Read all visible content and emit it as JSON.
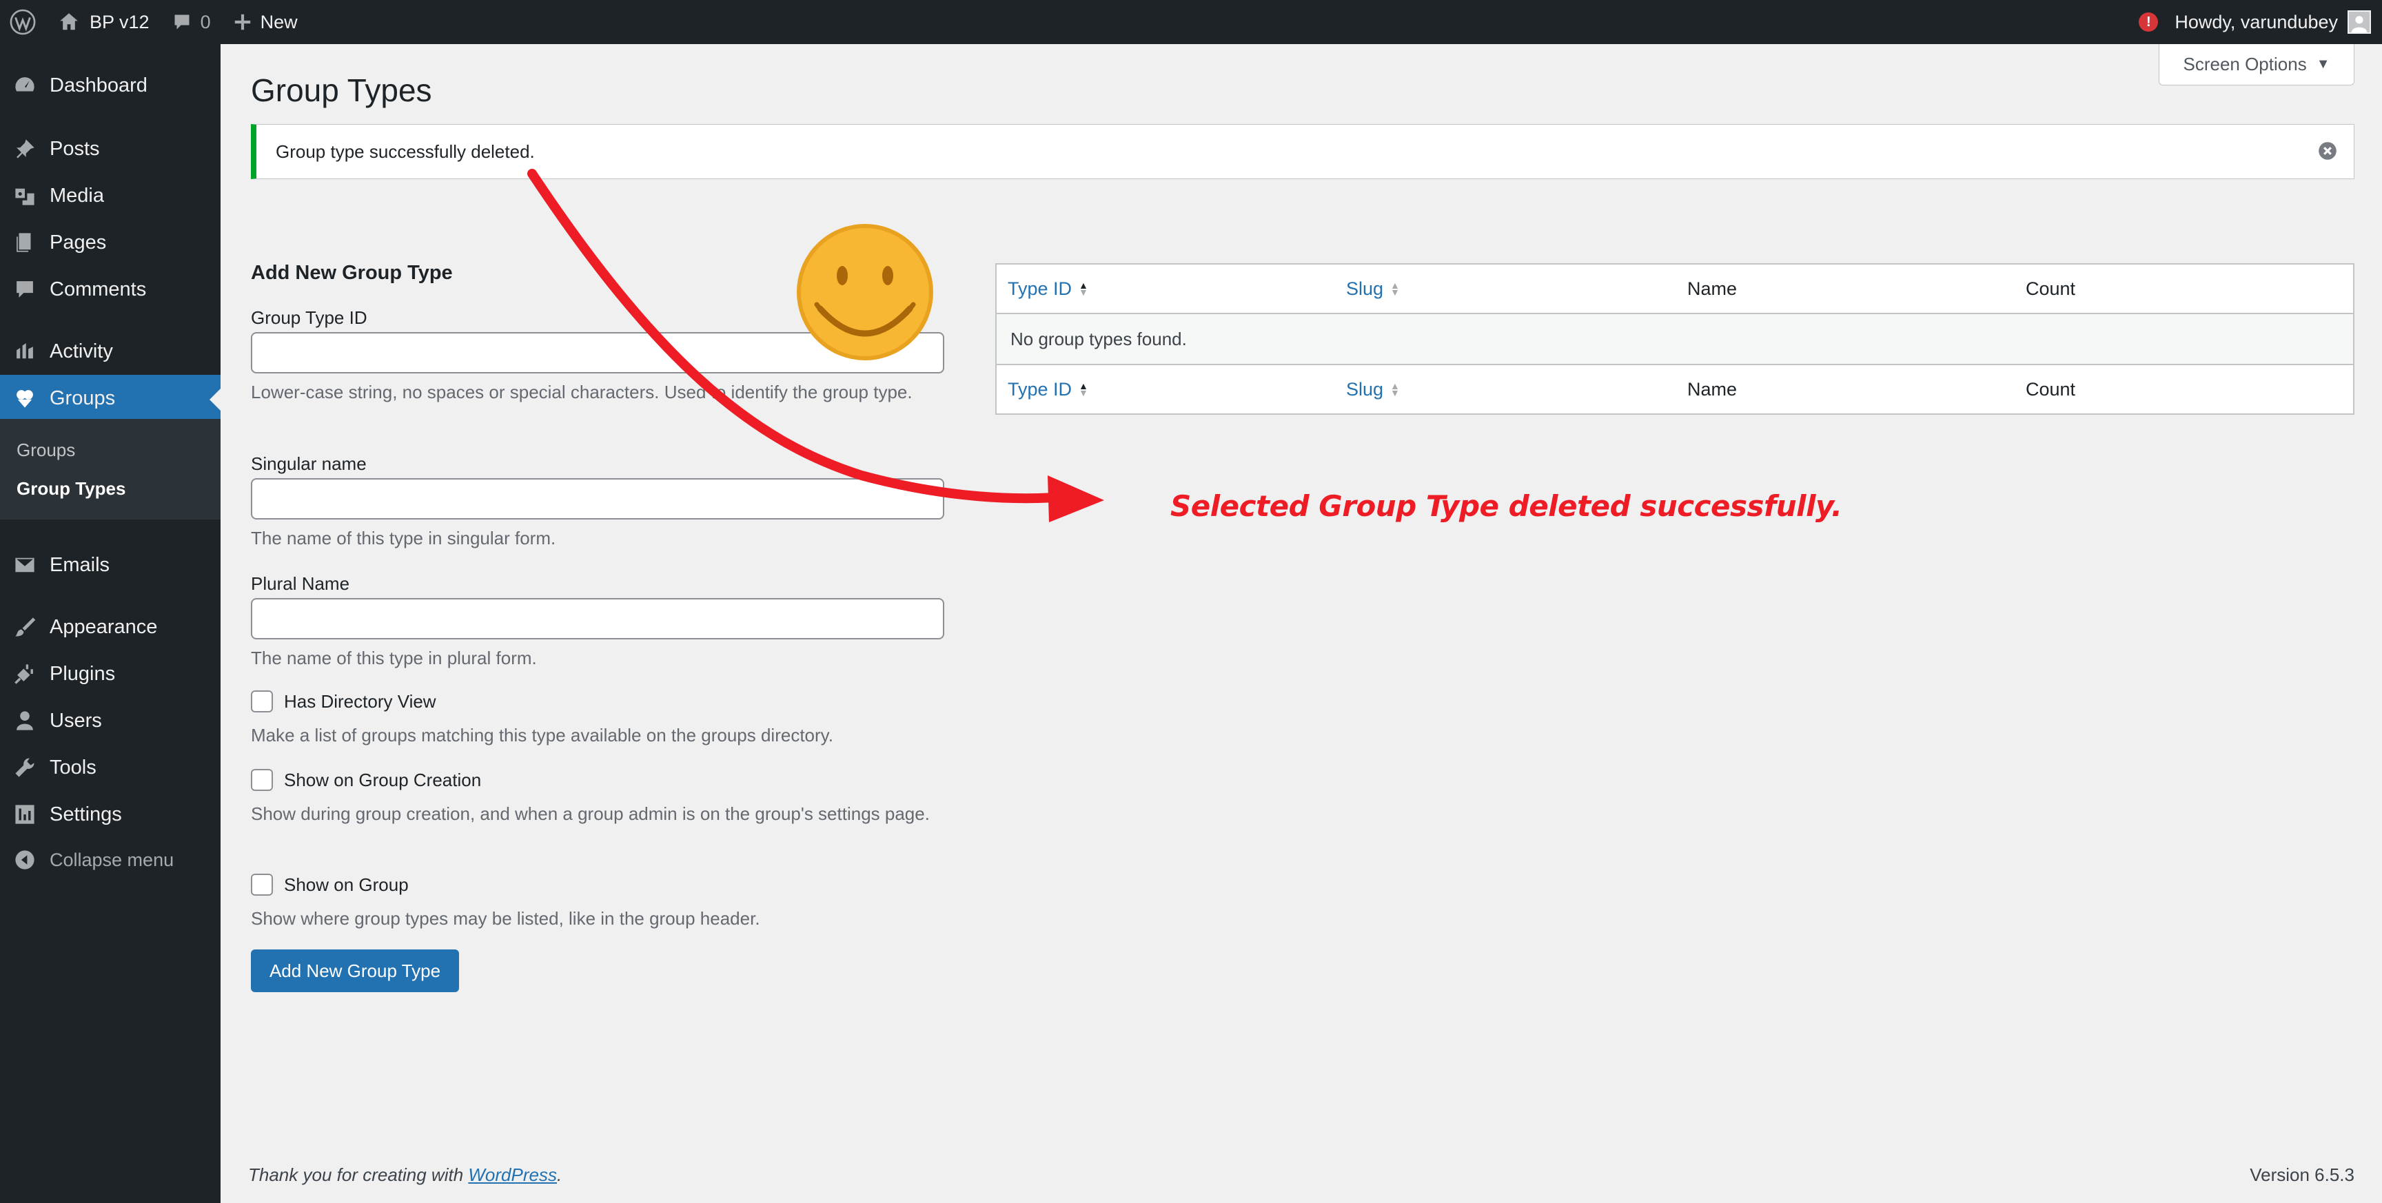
{
  "adminbar": {
    "site_name": "BP v12",
    "comments_count": "0",
    "new_label": "New",
    "howdy": "Howdy, varundubey",
    "notice_badge": "!"
  },
  "sidebar": {
    "items": [
      {
        "label": "Dashboard",
        "icon": "dashboard-icon"
      },
      {
        "label": "Posts",
        "icon": "pin-icon"
      },
      {
        "label": "Media",
        "icon": "media-icon"
      },
      {
        "label": "Pages",
        "icon": "pages-icon"
      },
      {
        "label": "Comments",
        "icon": "comment-icon"
      },
      {
        "label": "Activity",
        "icon": "activity-icon"
      },
      {
        "label": "Groups",
        "icon": "groups-icon"
      },
      {
        "label": "Emails",
        "icon": "email-icon"
      },
      {
        "label": "Appearance",
        "icon": "brush-icon"
      },
      {
        "label": "Plugins",
        "icon": "plug-icon"
      },
      {
        "label": "Users",
        "icon": "user-icon"
      },
      {
        "label": "Tools",
        "icon": "wrench-icon"
      },
      {
        "label": "Settings",
        "icon": "settings-icon"
      }
    ],
    "submenu": [
      "Groups",
      "Group Types"
    ],
    "collapse_label": "Collapse menu"
  },
  "screen_options": "Screen Options",
  "page_title": "Group Types",
  "notice": "Group type successfully deleted.",
  "form": {
    "title": "Add New Group Type",
    "type_id_label": "Group Type ID",
    "type_id_help": "Lower-case string, no spaces or special characters. Used to identify the group type.",
    "singular_label": "Singular name",
    "singular_help": "The name of this type in singular form.",
    "plural_label": "Plural Name",
    "plural_help": "The name of this type in plural form.",
    "directory_label": "Has Directory View",
    "directory_help": "Make a list of groups matching this type available on the groups directory.",
    "creation_label": "Show on Group Creation",
    "creation_help": "Show during group creation, and when a group admin is on the group's settings page.",
    "show_group_label": "Show on Group",
    "show_group_help": "Show where group types may be listed, like in the group header.",
    "submit_label": "Add New Group Type"
  },
  "table": {
    "columns": [
      "Type ID",
      "Slug",
      "Name",
      "Count"
    ],
    "empty_message": "No group types found."
  },
  "annotation_text": "Selected Group Type deleted successfully.",
  "footer": {
    "thanks_prefix": "Thank you for creating with ",
    "thanks_link": "WordPress",
    "thanks_suffix": ".",
    "version": "Version 6.5.3"
  },
  "colors": {
    "admin_bg": "#1d2327",
    "accent": "#2271b1",
    "success": "#00a32a",
    "annotation": "#ee1c24",
    "smiley": "#f7b733"
  }
}
